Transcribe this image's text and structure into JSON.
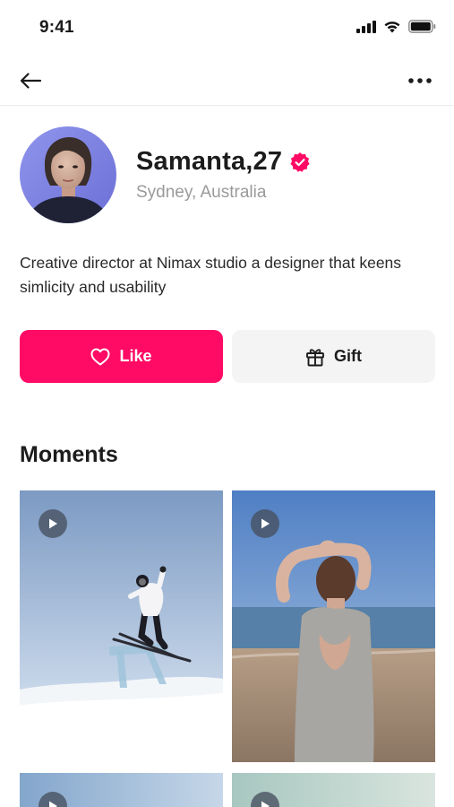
{
  "status_bar": {
    "time": "9:41",
    "icons": [
      "signal-icon",
      "wifi-icon",
      "battery-icon"
    ]
  },
  "nav": {
    "back_icon": "arrow-left-icon",
    "more_icon": "more-horizontal-icon"
  },
  "profile": {
    "name": "Samanta,27",
    "verified": true,
    "location": "Sydney, Australia",
    "bio": "Creative director at Nimax studio a designer that keens simlicity and usability"
  },
  "actions": {
    "like_label": "Like",
    "like_icon": "heart-icon",
    "gift_label": "Gift",
    "gift_icon": "gift-icon"
  },
  "moments": {
    "title": "Moments",
    "items": [
      {
        "type": "video",
        "scene": "skier"
      },
      {
        "type": "video",
        "scene": "beach"
      },
      {
        "type": "video",
        "scene": "sky"
      },
      {
        "type": "video",
        "scene": "sea"
      }
    ]
  },
  "colors": {
    "accent": "#ff0a64",
    "secondary_button": "#f4f4f5",
    "muted_text": "#9a9a9a"
  }
}
